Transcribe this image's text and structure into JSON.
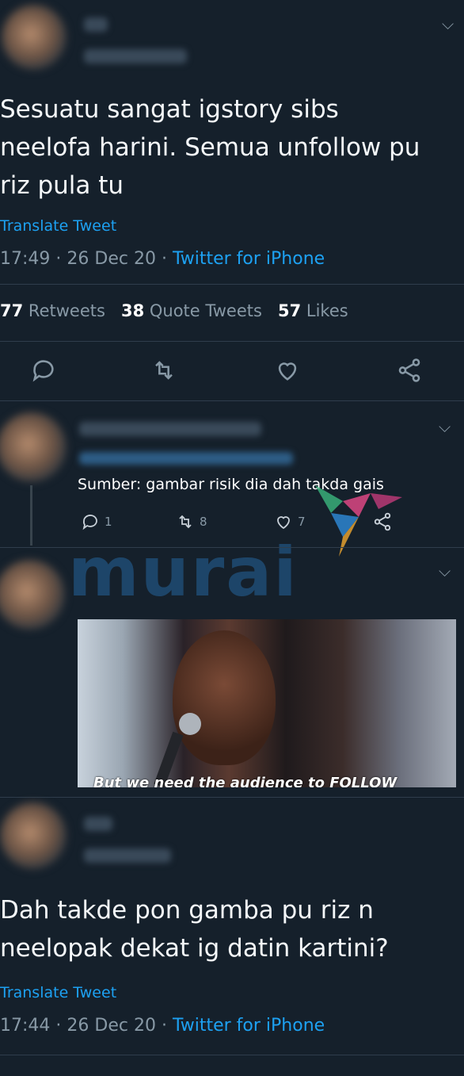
{
  "tweet1": {
    "text_lines": [
      "Sesuatu sangat igstory sibs",
      "neelofa harini. Semua unfollow pu",
      "riz pula tu"
    ],
    "translate": "Translate Tweet",
    "time": "17:49",
    "date": "26 Dec 20",
    "source": "Twitter for iPhone",
    "retweets_count": "77",
    "retweets_label": "Retweets",
    "quotes_count": "38",
    "quotes_label": "Quote Tweets",
    "likes_count": "57",
    "likes_label": "Likes"
  },
  "reply": {
    "text": "Sumber: gambar risik dia dah takda gais",
    "reply_count": "1",
    "retweet_count": "8",
    "like_count": "7"
  },
  "gif_tweet": {
    "caption": "But we need the audience to FOLLOW"
  },
  "watermark": "murai",
  "tweet2": {
    "text_lines": [
      "Dah takde pon gamba pu riz n",
      "neelopak dekat ig datin kartini?"
    ],
    "translate": "Translate Tweet",
    "time": "17:44",
    "date": "26 Dec 20",
    "source": "Twitter for iPhone"
  },
  "colors": {
    "background": "#15202b",
    "accent": "#1da1f2",
    "muted": "#8899a6"
  }
}
